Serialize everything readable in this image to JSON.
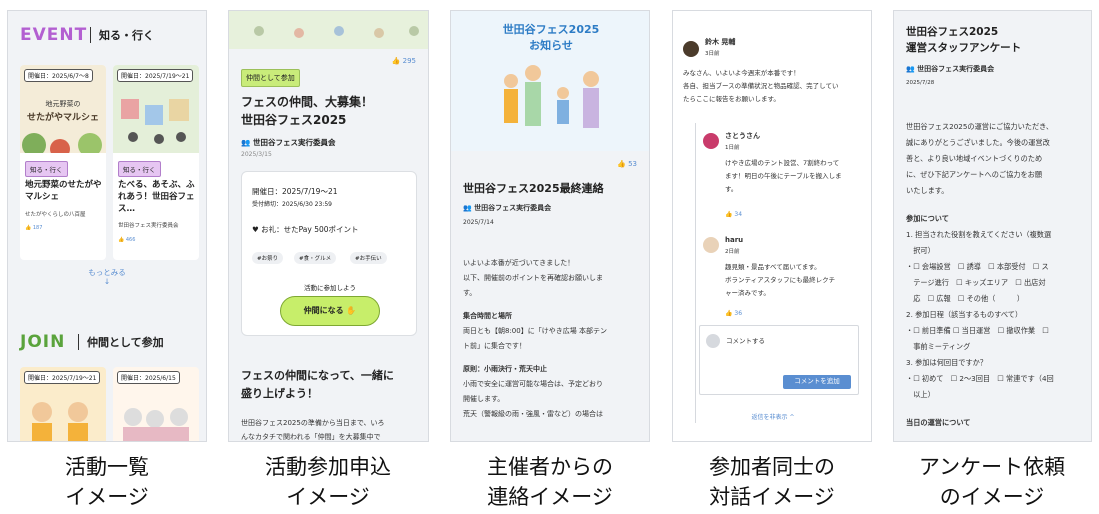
{
  "panel1": {
    "event_label": "EVENT",
    "event_sub": "知る・行く",
    "card1": {
      "date": "開催日：2025/6/7〜8",
      "thumb_text": "地元野菜の",
      "thumb_big": "せたがやマルシェ",
      "tag": "知る・行く",
      "title": "地元野菜のせたがやマルシェ",
      "org": "せたがやくらしの八百屋",
      "likes": "187"
    },
    "card2": {
      "date": "開催日：2025/7/19〜21",
      "tag": "知る・行く",
      "title": "たべる、あそぶ、ふれあう！世田谷フェス…",
      "org": "世田谷フェス実行委員会",
      "likes": "466"
    },
    "more": "もっとみる",
    "more_arrow": "↓",
    "join_label": "JOIN",
    "join_sub": "仲間として参加",
    "card3": {
      "date": "開催日：2025/7/19〜21"
    },
    "card4": {
      "date": "開催日：2025/6/15"
    }
  },
  "panel2": {
    "likes": "295",
    "tag": "仲間として参加",
    "title1": "フェスの仲間、大募集！",
    "title2": "世田谷フェス2025",
    "org": "世田谷フェス実行委員会",
    "date": "2025/3/15",
    "event_date": "開催日：2025/7/19〜21",
    "deadline": "受付締切：2025/6/30 23:59",
    "reward": "お礼：せたPay 500ポイント",
    "pills": [
      "#お祭り",
      "#食・グルメ",
      "#お手伝い"
    ],
    "cta_hint": "活動に参加しよう",
    "cta": "仲間になる",
    "heading1": "フェスの仲間になって、一緒に",
    "heading2": "盛り上げよう！",
    "body1": "世田谷フェス2025の準備から当日まで、いろ",
    "body2": "んなカタチで関われる「仲間」を大募集中で"
  },
  "panel3": {
    "poster_title1": "世田谷フェス2025",
    "poster_title2": "お知らせ",
    "likes": "53",
    "title": "世田谷フェス2025最終連絡",
    "org": "世田谷フェス実行委員会",
    "date": "2025/7/14",
    "lines": [
      "いよいよ本番が近づいてきました！",
      "以下、開催前のポイントを再確認お願いしま",
      "す。",
      "",
      "集合時間と場所",
      "両日とも【朝8:00】に「けやき広場 本部テン",
      "ト前」に集合です！",
      "",
      "原則：小雨決行・荒天中止",
      "小雨で安全に運営可能な場合は、予定どおり",
      "開催します。",
      "荒天（警報級の雨・強風・雷など）の場合は"
    ]
  },
  "panel4": {
    "user1": "鈴木 晃輔",
    "time1": "3日前",
    "msg1": [
      "みなさん、いよいよ今週末が本番です！",
      "各自、担当ブースの準備状況と物品確認、完了してい",
      "たらここに報告をお願いします。"
    ],
    "user2": "さとうさん",
    "time2": "1日前",
    "msg2": [
      "けやき広場のテント設営、7割終わって",
      "ます！明日の午後にテーブルを搬入しま",
      "す。"
    ],
    "likes2": "34",
    "user3": "haru",
    "time3": "2日前",
    "msg3": [
      "趣見類・景品すべて届いてます。",
      "ボランティアスタッフにも最終レクチ",
      "ャー済みです。"
    ],
    "likes3": "36",
    "comment_placeholder": "コメントする",
    "add_button": "コメントを追加",
    "collapse": "返信を非表示 ^"
  },
  "panel5": {
    "title1": "世田谷フェス2025",
    "title2": "運営スタッフアンケート",
    "org": "世田谷フェス実行委員会",
    "date": "2025/7/28",
    "lines": [
      "世田谷フェス2025の運営にご協力いただき、",
      "誠にありがとうございました。今後の運営改",
      "善と、より良い地域イベントづくりのため",
      "に、ぜひ下記アンケートへのご協力をお願",
      "いたします。",
      "",
      "参加について",
      "1. 担当された役割を教えてください（複数選",
      "　択可）",
      "・☐ 会場設営　☐ 誘導　☐ 本部受付　☐ ス",
      "　テージ進行　☐ キッズエリア　☐ 出店対",
      "　応　☐ 広報　☐ その他（　　　）",
      "2. 参加日程（該当するものすべて）",
      "・☐ 前日準備 ☐ 当日運営　☐ 撤収作業　☐",
      "　事前ミーティング",
      "3. 参加は何回目ですか？",
      "・☐ 初めて　☐ 2〜3回目　☐ 常連です（4回",
      "　以上）",
      "",
      "当日の運営について"
    ]
  },
  "captions": [
    [
      "活動一覧",
      "イメージ"
    ],
    [
      "活動参加申込",
      "イメージ"
    ],
    [
      "主催者からの",
      "連絡イメージ"
    ],
    [
      "参加者同士の",
      "対話イメージ"
    ],
    [
      "アンケート依頼",
      "のイメージ"
    ]
  ],
  "colors": {
    "event": "#b35fd1",
    "join": "#5aa33c",
    "accent_blue": "#5a8ed1",
    "cta_green": "#c7ee6a"
  }
}
